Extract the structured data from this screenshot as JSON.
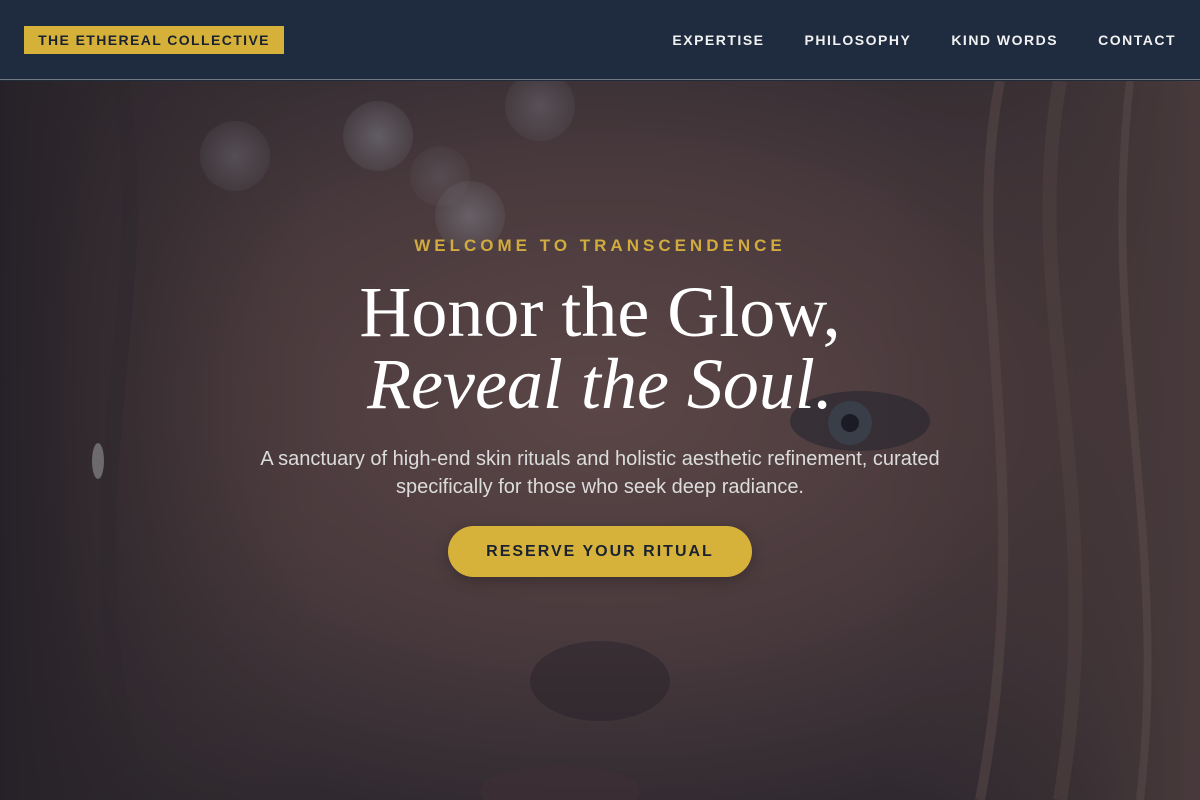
{
  "brand": {
    "name": "THE ETHEREAL COLLECTIVE",
    "accent_color": "#d6b13a",
    "header_color": "#1f2b3f"
  },
  "nav": {
    "items": [
      {
        "label": "EXPERTISE"
      },
      {
        "label": "PHILOSOPHY"
      },
      {
        "label": "KIND WORDS"
      },
      {
        "label": "CONTACT"
      }
    ]
  },
  "hero": {
    "eyebrow": "WELCOME TO TRANSCENDENCE",
    "headline_line1": "Honor the Glow,",
    "headline_line2": "Reveal the Soul.",
    "subtext": "A sanctuary of high-end skin rituals and holistic aesthetic refinement, curated specifically for those who seek deep radiance.",
    "cta_label": "RESERVE YOUR RITUAL",
    "background_image": "close-up-face-photo"
  }
}
